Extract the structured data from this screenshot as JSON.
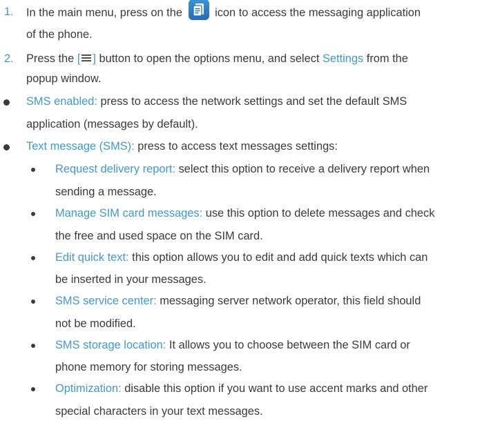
{
  "steps": [
    {
      "number": "1.",
      "line1_before_icon": "In the main menu, press on the",
      "icon": "messaging-app-icon",
      "line1_after_icon": "icon to access the messaging application",
      "line2": "of the phone."
    },
    {
      "number": "2.",
      "line1_before": "Press the",
      "button_open": "[",
      "button_icon": "menu-icon",
      "button_close": "]",
      "line1_middle": "button to open the options menu, and select",
      "link_settings": "Settings",
      "line1_after": "from the",
      "line2": "popup window."
    }
  ],
  "bullets": [
    {
      "term": "SMS enabled:",
      "line1_rest": "press to access the network settings and set the default SMS",
      "line2": "application (messages by default)."
    },
    {
      "term": "Text message (SMS):",
      "line1_rest": "press to access text messages settings:",
      "subitems": [
        {
          "term": "Request delivery report:",
          "line1_rest": "select this option to receive a delivery report when",
          "line2": "sending a message."
        },
        {
          "term": "Manage SIM card messages:",
          "line1_rest": "use this option to delete messages and check",
          "line2": "the free and used space on the SIM card."
        },
        {
          "term": "Edit quick text:",
          "line1_rest": "this option allows you to edit and add quick texts which can",
          "line2": "be inserted in your messages."
        },
        {
          "term": "SMS service center:",
          "line1_rest": "messaging server network operator, this field should",
          "line2": "not be modified."
        },
        {
          "term": "SMS storage location:",
          "line1_rest": "It allows you to choose between the SIM card or",
          "line2": "phone memory for storing messages."
        },
        {
          "term": "Optimization:",
          "line1_rest": "disable this option if you want to use accent marks and other",
          "line2": "special characters in your text messages."
        }
      ]
    }
  ],
  "colors": {
    "accent": "#3d9ad1",
    "text": "#3a3a3a",
    "icon": "#1f6fb8"
  }
}
